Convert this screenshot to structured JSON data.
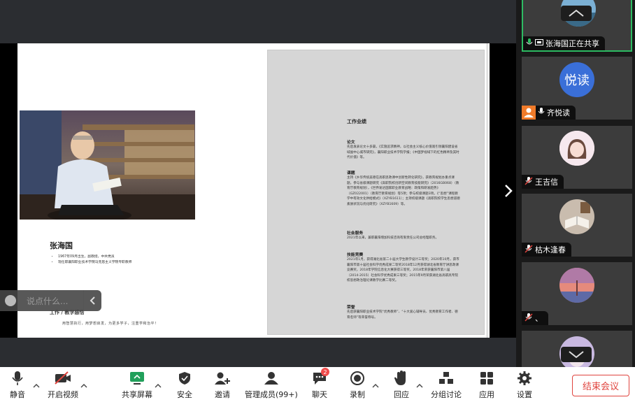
{
  "document": {
    "name": "张海国",
    "bio": [
      "1967年09月出生，副教授，中共党员",
      "现任职襄阳职业技术学院马克思主义学院专职教师"
    ],
    "work_heading": "工作 / 教学感悟",
    "motto": "用智慧执行，用梦想启发，为更多学子，注重学和治平！",
    "panel": {
      "title": "工作业绩",
      "sections": [
        {
          "heading": "论文",
          "body": "先后发表论文十多篇，《实施追求精神，以社会主义核心价值观引领襄阳建设省域副中心城市研究》，襄阳职业技术学院学报；《中国梦视域下的红色精神及其时代价值》等。"
        },
        {
          "heading": "课题",
          "body": "主持《乡华传统美德在高职思政课中创新性转化研究》，获教育规划办重点课题，参与省级课题研究《高职院校创新空间教育技能研究》（2016GB068）（教育厅教育规划），《世界发达国家职业教育战略：政策和研发趋势》（GZ022001）（教育厅教育规划）等5项；参与校级课题3项。《“思想”课程教学中有效文化供给模式》（XZYB1611）；主持校级课题《高职院校学生思想道德素质状况与优化研究》（XZYB1609）等。"
        },
        {
          "heading": "社会服务",
          "body": "2021年以来，兼职襄阳增加科技咨询有限责任公司总经理职务。"
        },
        {
          "heading": "技能竞赛",
          "body": "2021年1月，获得湖北省第二十届大学生教学设计三等奖；2020年10月，获市襄阳市第十届社会科学优秀成果二等奖2018年12月获得湖北省教育厅讲思政课竞赛奖，2018年学院信息化大赛获得三等奖，2018年荣获襄阳市第八届（2014-2015）社会科学优秀成果三等奖；2015年9月荣获湖北省高职高专院校思想政治理论课教学比赛二等奖。"
        },
        {
          "heading": "荣誉",
          "body": "先后获襄阳职业技术学院“优秀教师”、“十大爱心辅导员、优秀教育工作者、德育名师”等荣誉称号。"
        }
      ]
    }
  },
  "chat": {
    "placeholder": "说点什么..."
  },
  "participants": [
    {
      "name": "张海国正在共享",
      "status": "sharing",
      "avatar": "landscape-photo"
    },
    {
      "name": "齐悦读",
      "avatar_text": "悦读",
      "avatar_color": "#3a6fd8"
    },
    {
      "name": "王吉信",
      "avatar": "cartoon-girl"
    },
    {
      "name": "枯木逢春",
      "avatar": "open-book"
    },
    {
      "name": "、",
      "avatar": "sunset-tree"
    },
    {
      "name": "",
      "avatar": "purple-portrait"
    }
  ],
  "toolbar": {
    "mute": "静音",
    "video": "开启视频",
    "share": "共享屏幕",
    "security": "安全",
    "invite": "邀请",
    "members": "管理成员(99+)",
    "chat": "聊天",
    "chat_badge": "2",
    "record": "录制",
    "reaction": "回应",
    "breakout": "分组讨论",
    "apps": "应用",
    "settings": "设置",
    "end": "结束会议"
  },
  "colors": {
    "accent_green": "#2dbb62",
    "end_red": "#e0443e",
    "avatar_blue": "#3a6fd8"
  }
}
